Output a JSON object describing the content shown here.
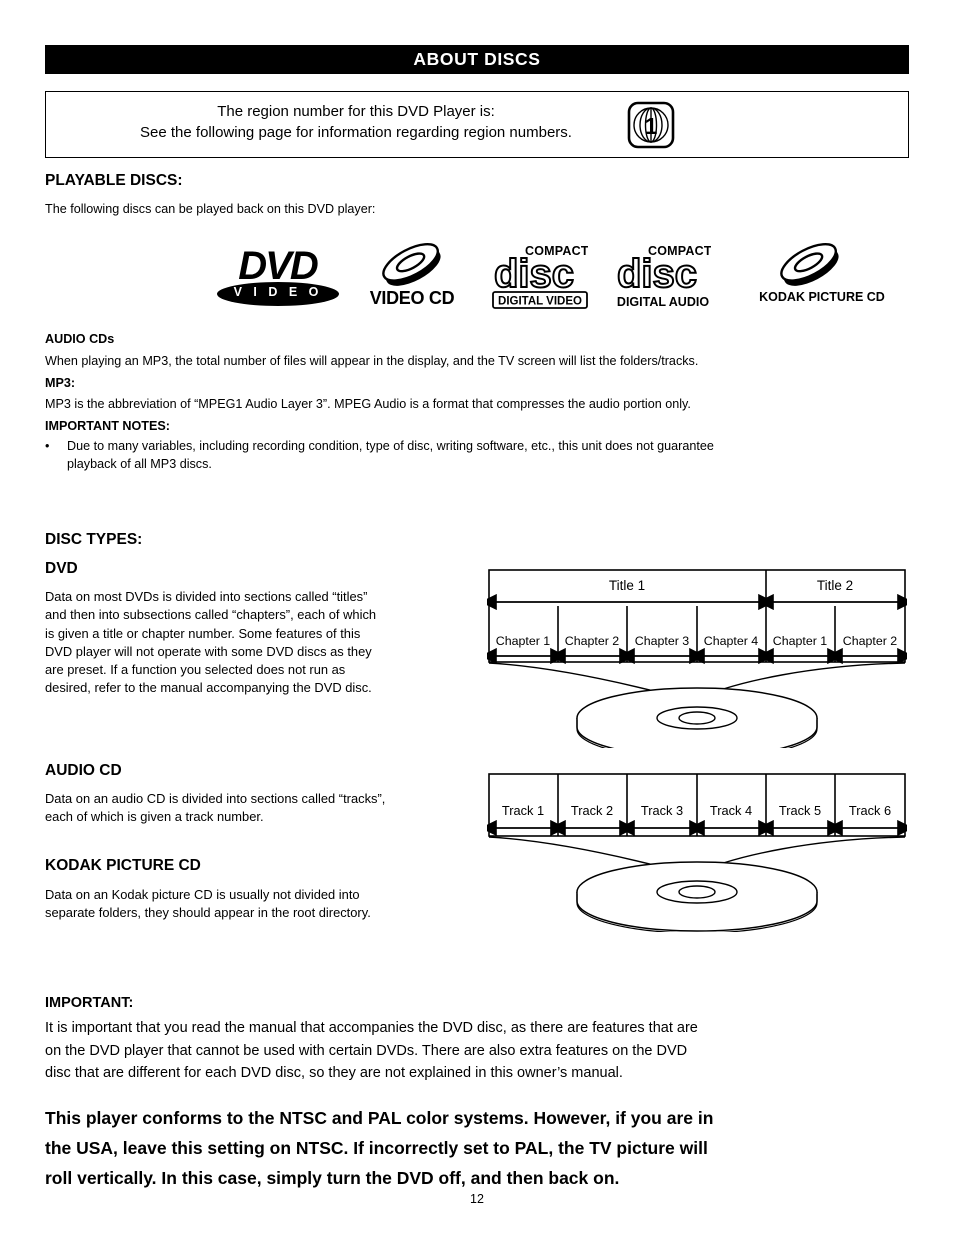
{
  "header": {
    "title": "ABOUT DISCS"
  },
  "region_box": {
    "line1": "The region number for this DVD Player is:",
    "line2": "See the following page for information regarding region numbers.",
    "region_number": "1"
  },
  "playable": {
    "heading": "PLAYABLE DISCS:",
    "intro": "The following discs can be played back on this DVD player:",
    "logos": [
      {
        "id": "dvd-video",
        "main": "DVD",
        "sub": "V I D E O"
      },
      {
        "id": "video-cd",
        "main": "VIDEO CD"
      },
      {
        "id": "compact-disc-digital-video",
        "top": "COMPACT",
        "main": "disc",
        "sub": "DIGITAL VIDEO"
      },
      {
        "id": "compact-disc-digital-audio",
        "top": "COMPACT",
        "main": "disc",
        "sub": "DIGITAL AUDIO"
      },
      {
        "id": "kodak-picture-cd",
        "main": "KODAK PICTURE CD"
      }
    ]
  },
  "audio_cds": {
    "heading": "AUDIO CDs",
    "text": "When playing an MP3, the total number of files will appear in the display, and the TV screen will list the folders/tracks."
  },
  "mp3": {
    "heading": "MP3:",
    "text": "MP3 is the abbreviation of “MPEG1 Audio Layer 3”. MPEG Audio is a format that compresses the audio portion only."
  },
  "important_notes": {
    "heading": "IMPORTANT NOTES:",
    "bullet_marker": "•",
    "bullet1_line1": "Due to many variables, including recording condition, type of disc, writing software, etc., this unit does not guarantee",
    "bullet1_line2": "playback of all MP3 discs."
  },
  "disc_types": {
    "heading": "DISC TYPES:",
    "dvd": {
      "heading": "DVD",
      "para": [
        "Data on most DVDs is divided into sections called “titles”",
        "and then into subsections called “chapters”, each of which",
        "is given a title or chapter number. Some features of this",
        "DVD player will not operate with some DVD discs as they",
        "are preset. If a function you selected does not run as",
        "desired, refer to the manual accompanying the DVD disc."
      ]
    },
    "audio_cd": {
      "heading": "AUDIO CD",
      "para": [
        "Data on an audio CD is divided into sections called “tracks”,",
        "each of which is given a track number."
      ]
    },
    "kodak_cd": {
      "heading": "KODAK PICTURE CD",
      "para": [
        "Data on an Kodak picture CD is usually not divided into",
        "separate folders, they should appear in the root directory."
      ]
    }
  },
  "dvd_diagram": {
    "titles": [
      {
        "label": "Title 1",
        "chapters": [
          "Chapter 1",
          "Chapter 2",
          "Chapter 3",
          "Chapter 4"
        ]
      },
      {
        "label": "Title 2",
        "chapters": [
          "Chapter 1",
          "Chapter 2"
        ]
      }
    ]
  },
  "cd_diagram": {
    "tracks": [
      "Track 1",
      "Track 2",
      "Track 3",
      "Track 4",
      "Track 5",
      "Track 6"
    ]
  },
  "important": {
    "heading": "IMPORTANT:",
    "para": [
      "It is important that you read the manual that accompanies the DVD disc, as there are features that are",
      "on the DVD player that cannot be used with certain DVDs. There are also extra features on the DVD",
      "disc that are different for each DVD disc, so they are not explained in this owner’s manual."
    ]
  },
  "conformance": {
    "lines": [
      "This player conforms to the NTSC and PAL color systems. However, if you are in",
      "the USA, leave this setting on NTSC. If incorrectly set to PAL, the TV picture will",
      "roll vertically. In this case, simply turn the DVD off, and then back on."
    ]
  },
  "footer": {
    "page_number": "12"
  }
}
